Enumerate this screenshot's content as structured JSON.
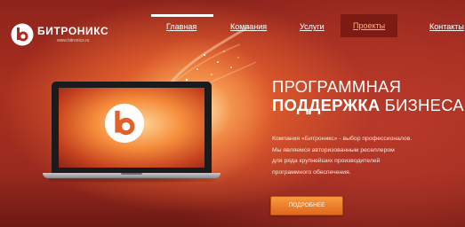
{
  "brand": {
    "name": "БИТРОНИКС",
    "tagline": "www.bitronics.ru"
  },
  "nav": {
    "items": [
      {
        "label": "Главная",
        "active": false
      },
      {
        "label": "Компания",
        "active": false
      },
      {
        "label": "Услуги",
        "active": false
      },
      {
        "label": "Проекты",
        "active": true
      },
      {
        "label": "Контакты",
        "active": false
      }
    ]
  },
  "hero": {
    "title_line1": "ПРОГРАММНАЯ",
    "title_line2_bold": "ПОДДЕРЖКА",
    "title_line2_rest": "БИЗНЕСА",
    "description": [
      "Компания «Битроникс» - выбор профессионалов.",
      "Мы являемся авторизованным реселлером",
      "для ряда крупнейших производителей",
      "программного обеспечения."
    ],
    "button_label": "ПОДРОБНЕЕ"
  },
  "colors": {
    "background": "#9b2a1f",
    "accent": "#f0822e",
    "active_nav_bg": "#7c1a14",
    "active_nav_text": "#ffb17e"
  },
  "icons": {
    "logo": "bitronix-logo-icon"
  }
}
